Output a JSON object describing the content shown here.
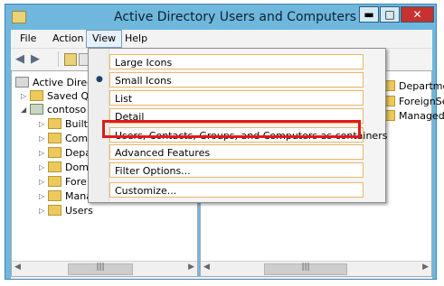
{
  "window": {
    "title": "Active Directory Users and Computers",
    "controls": {
      "minimize": "▬",
      "maximize": "□",
      "close": "✕"
    }
  },
  "menubar": {
    "items": [
      {
        "label": "File"
      },
      {
        "label": "Action"
      },
      {
        "label": "View"
      },
      {
        "label": "Help"
      }
    ]
  },
  "tree": {
    "root": "Active Directo",
    "items": [
      {
        "label": "Saved Q"
      },
      {
        "label": "contoso"
      },
      {
        "label": "Built"
      },
      {
        "label": "Com"
      },
      {
        "label": "Depa"
      },
      {
        "label": "Dom"
      },
      {
        "label": "Fore"
      },
      {
        "label": "Mana"
      },
      {
        "label": "Users"
      }
    ]
  },
  "right_pane": {
    "items": [
      {
        "label": "Departme"
      },
      {
        "label": "ForeignSe"
      },
      {
        "label": "Managed"
      }
    ]
  },
  "view_menu": {
    "items": [
      {
        "label": "Large Icons"
      },
      {
        "label": "Small Icons",
        "selected": true
      },
      {
        "label": "List"
      },
      {
        "label": "Detail"
      },
      {
        "label": "Users, Contacts, Groups, and Computers as containers",
        "highlighted": true
      },
      {
        "label": "Advanced Features"
      },
      {
        "label": "Filter Options..."
      },
      {
        "label": "Customize..."
      }
    ]
  },
  "colors": {
    "accent_highlight": "#e01a1a",
    "window_frame": "#6fb7dd",
    "close_button": "#c7312f"
  }
}
